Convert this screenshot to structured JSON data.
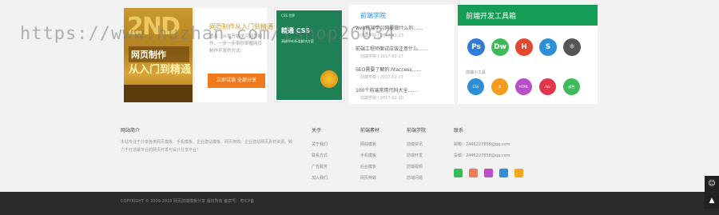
{
  "featured": {
    "cover_big": "2ND",
    "cover_line1": "网页制作",
    "cover_line2": "从入门到精通",
    "title": "网页制作从入门到精通",
    "desc": "适合：从零开始学习网页制作，一步一步带你掌握网页制作开发的方法！",
    "button": "立即试读 全部分享"
  },
  "book2": {
    "header": "CSS 世界",
    "title": "精通 CSS",
    "subtitle": "高级Web标准解决方案"
  },
  "news": {
    "heading": "前端学院",
    "items": [
      {
        "title": "web前端学习网要做什么的……",
        "meta": "前端学院 | 2017-01-23"
      },
      {
        "title": "前端工程师面试应该注意什么……",
        "meta": "前端学院 | 2017-02-17"
      },
      {
        "title": "SEO需要了解的.htaccess……",
        "meta": "前端学院 | 2017-02-17"
      },
      {
        "title": "100个前端常用代码大全……",
        "meta": "前端学院 | 2017-02-10"
      }
    ]
  },
  "tools": {
    "title": "前端开发工具箱",
    "icons": [
      {
        "label": "Ps",
        "color": "#2f7bd6"
      },
      {
        "label": "Dw",
        "color": "#3dbb5a"
      },
      {
        "label": "H",
        "color": "#e3472d"
      },
      {
        "label": "S",
        "color": "#2e8ed8"
      },
      {
        "label": "⚛",
        "color": "#555555"
      }
    ],
    "subtitle": "前端小工具",
    "small": [
      {
        "label": "CSS",
        "color": "#2e8ed8"
      },
      {
        "label": "JS",
        "color": "#f59c1a"
      },
      {
        "label": "HTML",
        "color": "#b94fc8"
      },
      {
        "label": "A/a",
        "color": "#e2374a"
      },
      {
        "label": "颜色",
        "color": "#3dbb5a"
      }
    ]
  },
  "footer": {
    "about_title": "网站简介",
    "about_text": "本站专注于分享各类网页模板、手机模板、企业建站模板、网页特效、企业建站网页素材资源，致力于打造最专业的网页开发与设计分享平台！",
    "col1": {
      "title": "关于",
      "links": [
        "关于我们",
        "联系方式",
        "广告服务",
        "加入我们"
      ]
    },
    "col2": {
      "title": "前端素材",
      "links": [
        "网站模板",
        "手机模板",
        "后台模板",
        "网页特效"
      ]
    },
    "col3": {
      "title": "前端学院",
      "links": [
        "前端资讯",
        "前端开发",
        "前端视频",
        "前端问题"
      ]
    },
    "contact": {
      "title": "联系",
      "email": "邮箱：2446227858@qq.com",
      "qq": "投稿：2446227858@qq.com"
    },
    "social_colors": [
      "#3dbb5a",
      "#f07a5a",
      "#b94fc8",
      "#2e8ed8",
      "#f5a81a"
    ],
    "copyright": "COPYRIGHT © 2009-2018 网页前端模板分享 版权所有 备案号：粤ICP备",
    "watermark": "https://www.huzhan.com/ishop26034"
  }
}
